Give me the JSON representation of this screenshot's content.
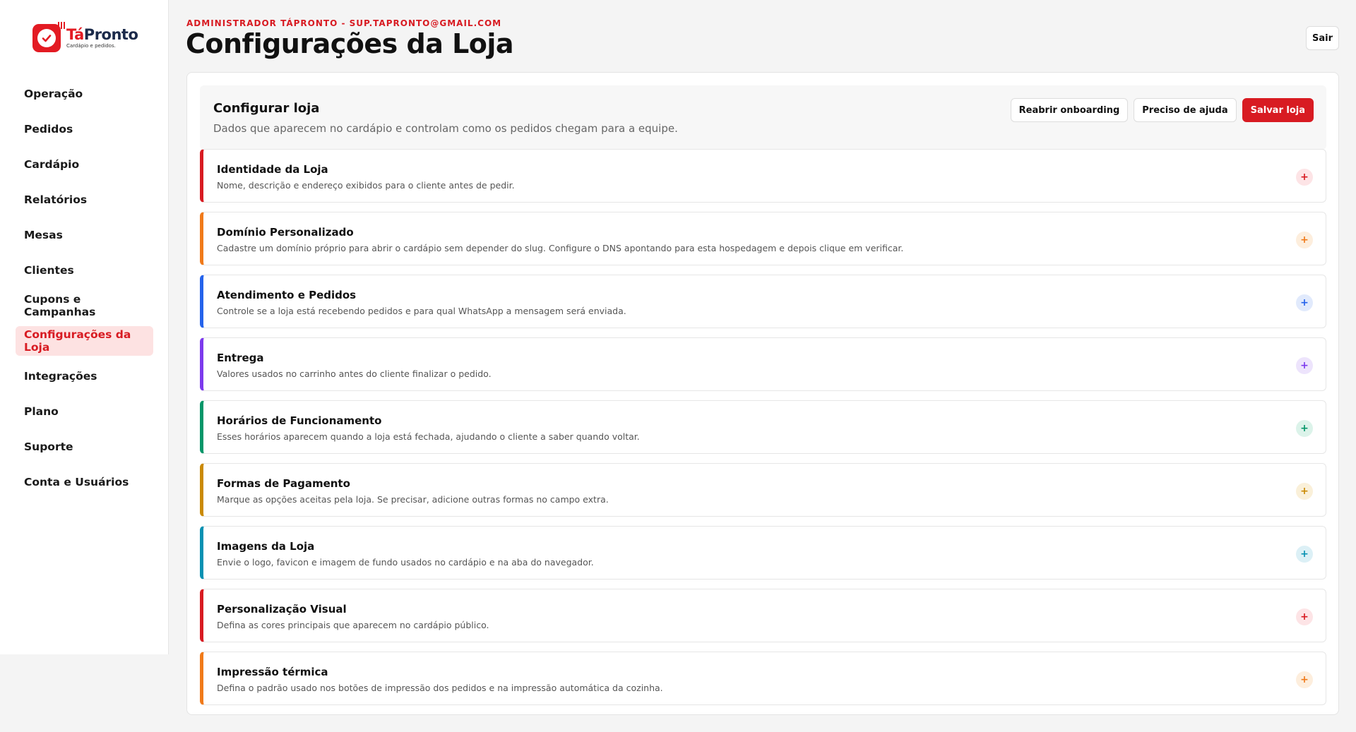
{
  "brand": {
    "name_part1": "Tá",
    "name_part2": "Pronto",
    "tagline": "Cardápio e pedidos.",
    "accent": "#d81b22"
  },
  "sidebar": {
    "items": [
      {
        "label": "Operação",
        "active": false
      },
      {
        "label": "Pedidos",
        "active": false
      },
      {
        "label": "Cardápio",
        "active": false
      },
      {
        "label": "Relatórios",
        "active": false
      },
      {
        "label": "Mesas",
        "active": false
      },
      {
        "label": "Clientes",
        "active": false
      },
      {
        "label": "Cupons e Campanhas",
        "active": false
      },
      {
        "label": "Configurações da Loja",
        "active": true
      },
      {
        "label": "Integrações",
        "active": false
      },
      {
        "label": "Plano",
        "active": false
      },
      {
        "label": "Suporte",
        "active": false
      },
      {
        "label": "Conta e Usuários",
        "active": false
      }
    ]
  },
  "header": {
    "eyebrow": "ADMINISTRADOR TÁPRONTO - SUP.TAPRONTO@GMAIL.COM",
    "title": "Configurações da Loja",
    "logout_label": "Sair"
  },
  "panel": {
    "title": "Configurar loja",
    "subtitle": "Dados que aparecem no cardápio e controlam como os pedidos chegam para a equipe.",
    "actions": {
      "reopen_onboarding": "Reabrir onboarding",
      "need_help": "Preciso de ajuda",
      "save": "Salvar loja"
    }
  },
  "sections": [
    {
      "title": "Identidade da Loja",
      "description": "Nome, descrição e endereço exibidos para o cliente antes de pedir.",
      "color": "#d81b22",
      "toggle_bg": "#fde4e6",
      "toggle_icon": "+"
    },
    {
      "title": "Domínio Personalizado",
      "description": "Cadastre um domínio próprio para abrir o cardápio sem depender do slug. Configure o DNS apontando para esta hospedagem e depois clique em verificar.",
      "color": "#f07a1a",
      "toggle_bg": "#fdeedd",
      "toggle_icon": "+"
    },
    {
      "title": "Atendimento e Pedidos",
      "description": "Controle se a loja está recebendo pedidos e para qual WhatsApp a mensagem será enviada.",
      "color": "#2563eb",
      "toggle_bg": "#e1eafc",
      "toggle_icon": "+"
    },
    {
      "title": "Entrega",
      "description": "Valores usados no carrinho antes do cliente finalizar o pedido.",
      "color": "#7c3aed",
      "toggle_bg": "#ede4fc",
      "toggle_icon": "+"
    },
    {
      "title": "Horários de Funcionamento",
      "description": "Esses horários aparecem quando a loja está fechada, ajudando o cliente a saber quando voltar.",
      "color": "#059669",
      "toggle_bg": "#dcf3ea",
      "toggle_icon": "+"
    },
    {
      "title": "Formas de Pagamento",
      "description": "Marque as opções aceitas pela loja. Se precisar, adicione outras formas no campo extra.",
      "color": "#ca8a04",
      "toggle_bg": "#faf0d9",
      "toggle_icon": "+"
    },
    {
      "title": "Imagens da Loja",
      "description": "Envie o logo, favicon e imagem de fundo usados no cardápio e na aba do navegador.",
      "color": "#0891b2",
      "toggle_bg": "#dcf0f6",
      "toggle_icon": "+"
    },
    {
      "title": "Personalização Visual",
      "description": "Defina as cores principais que aparecem no cardápio público.",
      "color": "#d81b22",
      "toggle_bg": "#fde4e6",
      "toggle_icon": "+"
    },
    {
      "title": "Impressão térmica",
      "description": "Defina o padrão usado nos botões de impressão dos pedidos e na impressão automática da cozinha.",
      "color": "#f07a1a",
      "toggle_bg": "#fdeedd",
      "toggle_icon": "+"
    }
  ]
}
